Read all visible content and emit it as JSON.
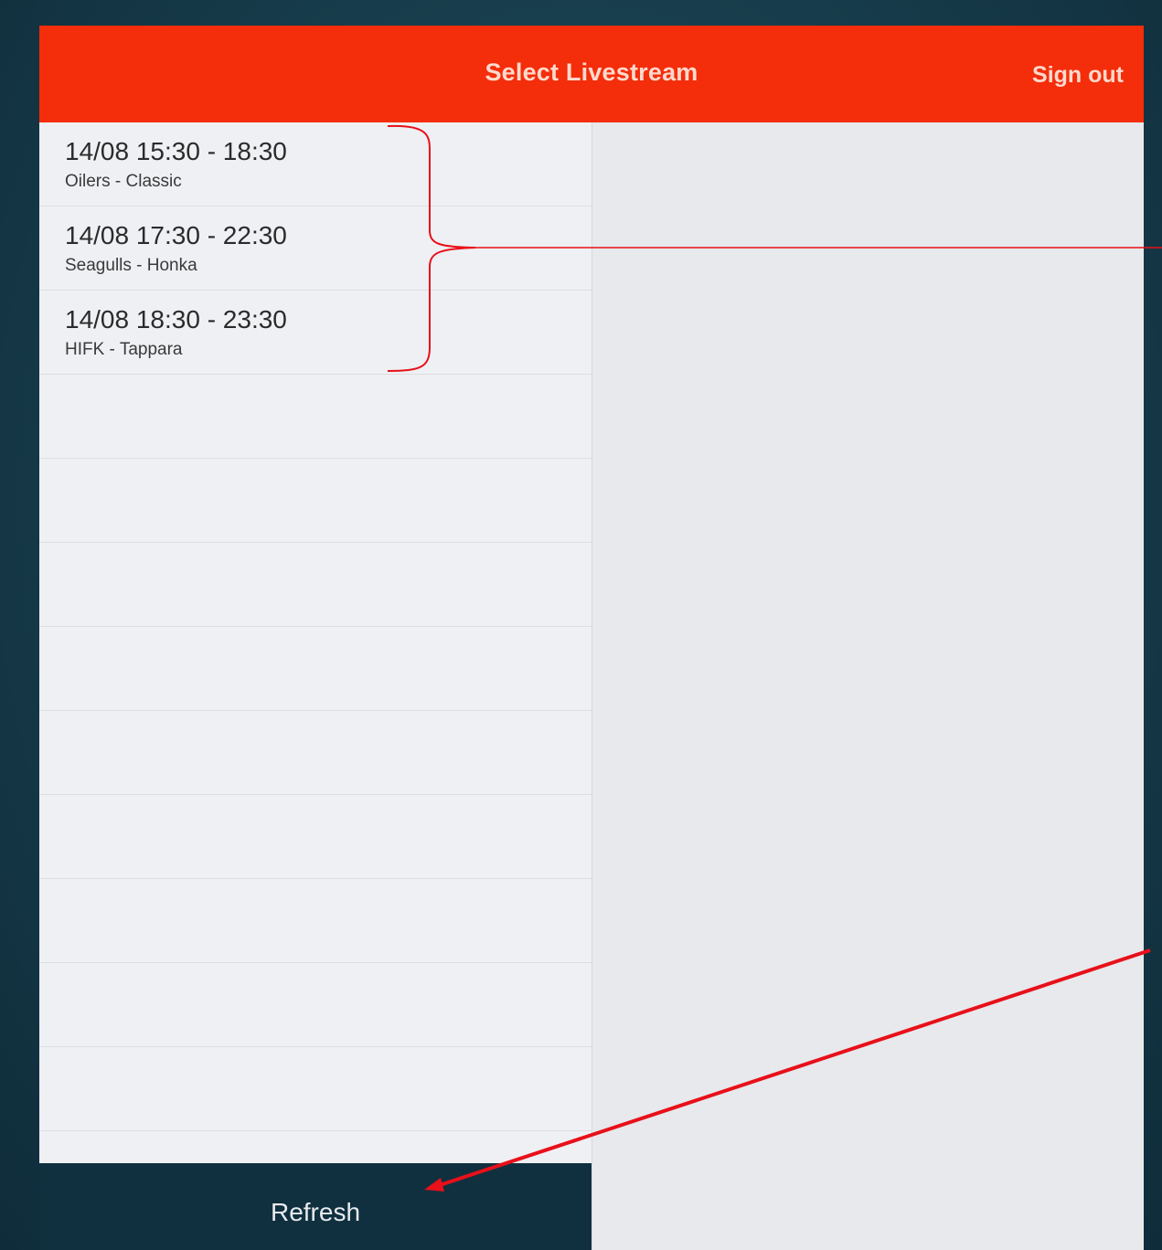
{
  "header": {
    "title": "Select Livestream",
    "sign_out_label": "Sign out"
  },
  "streams": [
    {
      "time": "14/08 15:30 - 18:30",
      "teams": "Oilers - Classic"
    },
    {
      "time": "14/08 17:30 - 22:30",
      "teams": "Seagulls - Honka"
    },
    {
      "time": "14/08 18:30 - 23:30",
      "teams": "HIFK - Tappara"
    }
  ],
  "footer": {
    "refresh_label": "Refresh"
  },
  "colors": {
    "nav_bar": "#f42d0b",
    "footer_bar": "#10303f",
    "annotation": "#e8101a"
  }
}
